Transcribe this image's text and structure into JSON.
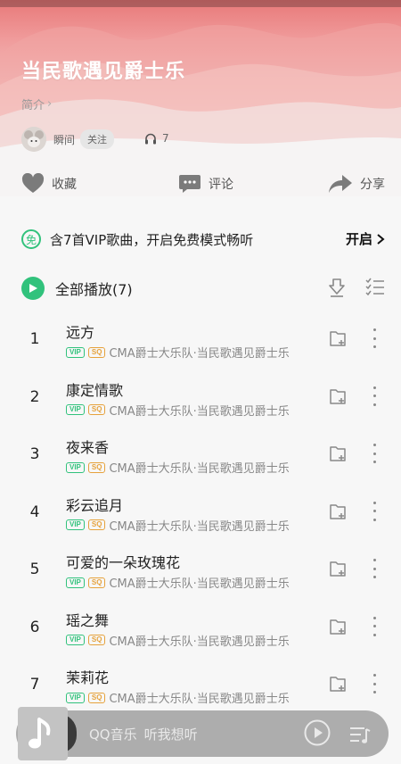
{
  "album": {
    "title": "当民歌遇见爵士乐",
    "intro_label": "简介",
    "creator_name": "瞬间",
    "follow_label": "关注",
    "listen_count": "7"
  },
  "actions": {
    "favorite": "收藏",
    "comment": "评论",
    "share": "分享"
  },
  "vip_banner": {
    "badge": "免",
    "text": "含7首VIP歌曲，开启免费模式畅听",
    "open_label": "开启"
  },
  "play_all": {
    "label": "全部播放(7)"
  },
  "songs": [
    {
      "index": "1",
      "name": "远方",
      "artist_album": "CMA爵士大乐队·当民歌遇见爵士乐"
    },
    {
      "index": "2",
      "name": "康定情歌",
      "artist_album": "CMA爵士大乐队·当民歌遇见爵士乐"
    },
    {
      "index": "3",
      "name": "夜来香",
      "artist_album": "CMA爵士大乐队·当民歌遇见爵士乐"
    },
    {
      "index": "4",
      "name": "彩云追月",
      "artist_album": "CMA爵士大乐队·当民歌遇见爵士乐"
    },
    {
      "index": "5",
      "name": "可爱的一朵玫瑰花",
      "artist_album": "CMA爵士大乐队·当民歌遇见爵士乐"
    },
    {
      "index": "6",
      "name": "瑶之舞",
      "artist_album": "CMA爵士大乐队·当民歌遇见爵士乐"
    },
    {
      "index": "7",
      "name": "茉莉花",
      "artist_album": "CMA爵士大乐队·当民歌遇见爵士乐"
    }
  ],
  "tags": {
    "vip": "VIP",
    "sq": "SQ"
  },
  "mini_player": {
    "app": "QQ音乐",
    "slogan": "听我想听"
  },
  "colors": {
    "accent_green": "#31c27c",
    "sq_orange": "#e6a23c",
    "hero_top": "#e87979"
  },
  "icons": {
    "favorite": "heart-icon",
    "comment": "comment-bubble-icon",
    "share": "share-arrow-icon",
    "headphones": "headphones-icon",
    "download": "download-icon",
    "multi_select": "list-check-icon",
    "add_to_playlist": "folder-add-icon",
    "more": "more-vertical-icon",
    "play": "play-icon",
    "playlist": "playlist-icon"
  }
}
